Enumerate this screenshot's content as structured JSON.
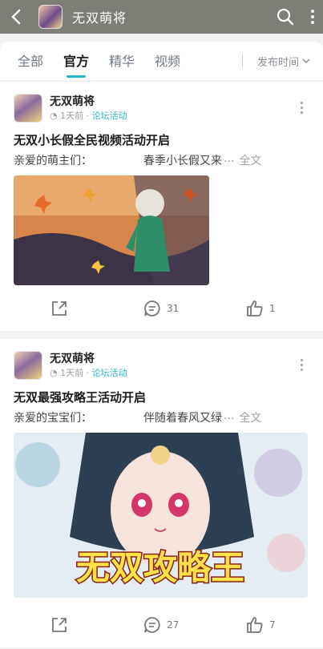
{
  "header": {
    "title": "无双萌将",
    "back_icon": "back-arrow-icon",
    "search_icon": "search-icon",
    "menu_icon": "more-vertical-icon"
  },
  "tabs": [
    {
      "label": "全部",
      "active": false
    },
    {
      "label": "官方",
      "active": true
    },
    {
      "label": "精华",
      "active": false
    },
    {
      "label": "视频",
      "active": false
    }
  ],
  "sort": {
    "label": "发布时间"
  },
  "posts": [
    {
      "author": "无双萌将",
      "time": "1天前",
      "category": "论坛活动",
      "title": "无双小长假全民视频活动开启",
      "excerpt_start": "亲爱的萌主们：",
      "excerpt_end": "春季小长假又来",
      "ellipsis": "...",
      "full_link": "全文",
      "comments": "31",
      "likes": "1"
    },
    {
      "author": "无双萌将",
      "time": "1天前",
      "category": "论坛活动",
      "title": "无双最强攻略王活动开启",
      "excerpt_start": "亲爱的宝宝们：",
      "excerpt_end": "伴随着春风又绿",
      "ellipsis": "...",
      "full_link": "全文",
      "comments": "27",
      "likes": "7",
      "banner_text": "无双攻略王"
    }
  ]
}
